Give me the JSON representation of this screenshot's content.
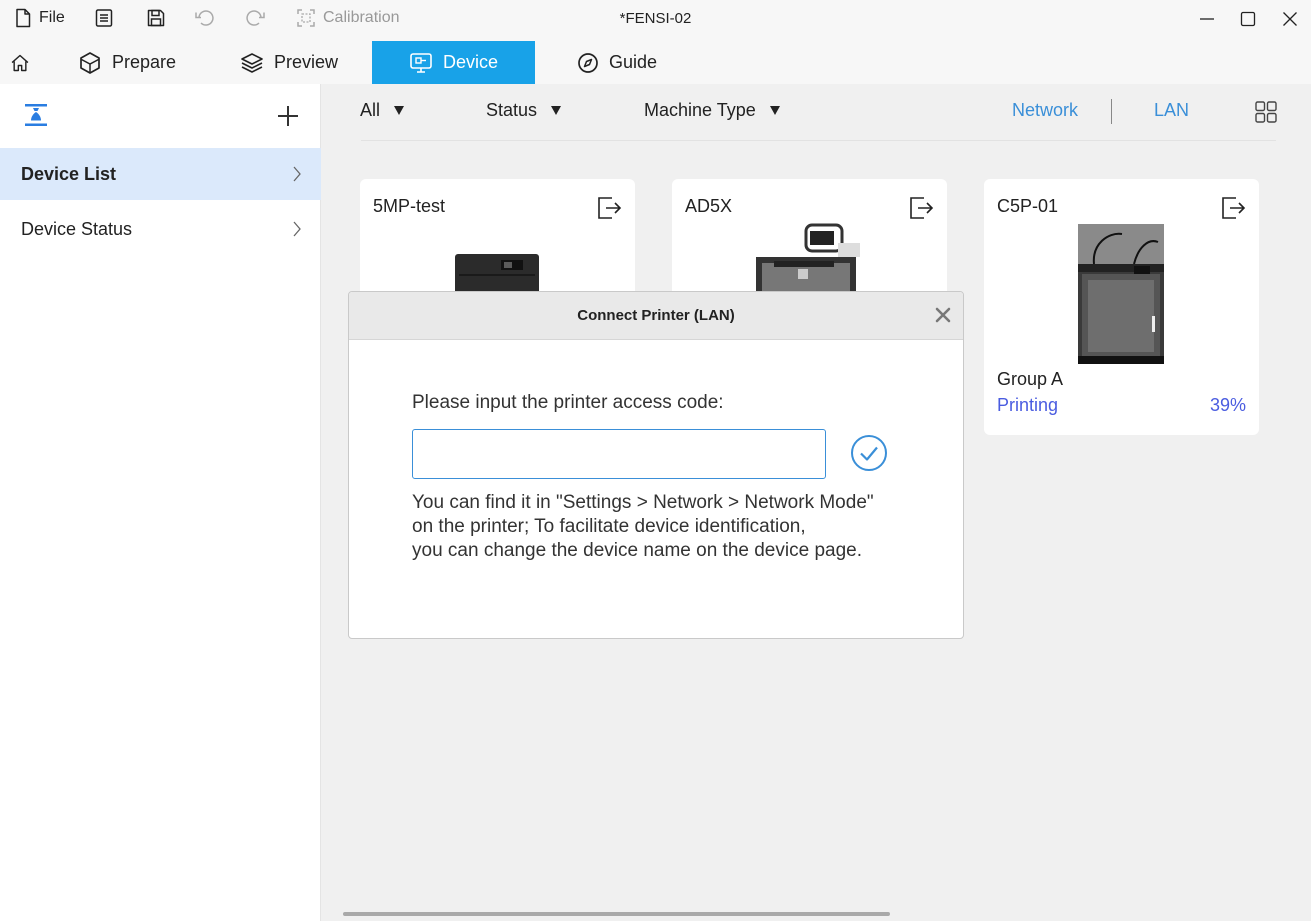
{
  "titlebar": {
    "file_label": "File",
    "calibration_label": "Calibration",
    "window_title": "*FENSI-02"
  },
  "tabs": [
    {
      "label": "Prepare"
    },
    {
      "label": "Preview"
    },
    {
      "label": "Device"
    },
    {
      "label": "Guide"
    }
  ],
  "active_tab": "Device",
  "sidebar": {
    "items": [
      {
        "label": "Device List",
        "selected": true
      },
      {
        "label": "Device Status",
        "selected": false
      }
    ]
  },
  "filters": {
    "all": "All",
    "status": "Status",
    "machine_type": "Machine Type",
    "network": "Network",
    "lan": "LAN"
  },
  "devices": [
    {
      "name": "5MP-test"
    },
    {
      "name": "AD5X"
    },
    {
      "name": "C5P-01",
      "group": "Group A",
      "status": "Printing",
      "progress": "39%"
    }
  ],
  "dialog": {
    "title": "Connect Printer (LAN)",
    "prompt": "Please input the printer access code:",
    "input_value": "",
    "input_placeholder": "",
    "help_lines": [
      "You can find it in \"Settings > Network > Network Mode\"",
      "on the printer; To facilitate device identification,",
      "you can change the device name on the device page."
    ]
  },
  "colors": {
    "accent": "#18a2e8",
    "link": "#3a8fd8",
    "status": "#4a5ce0",
    "selected_bg": "#dbe9fb"
  }
}
